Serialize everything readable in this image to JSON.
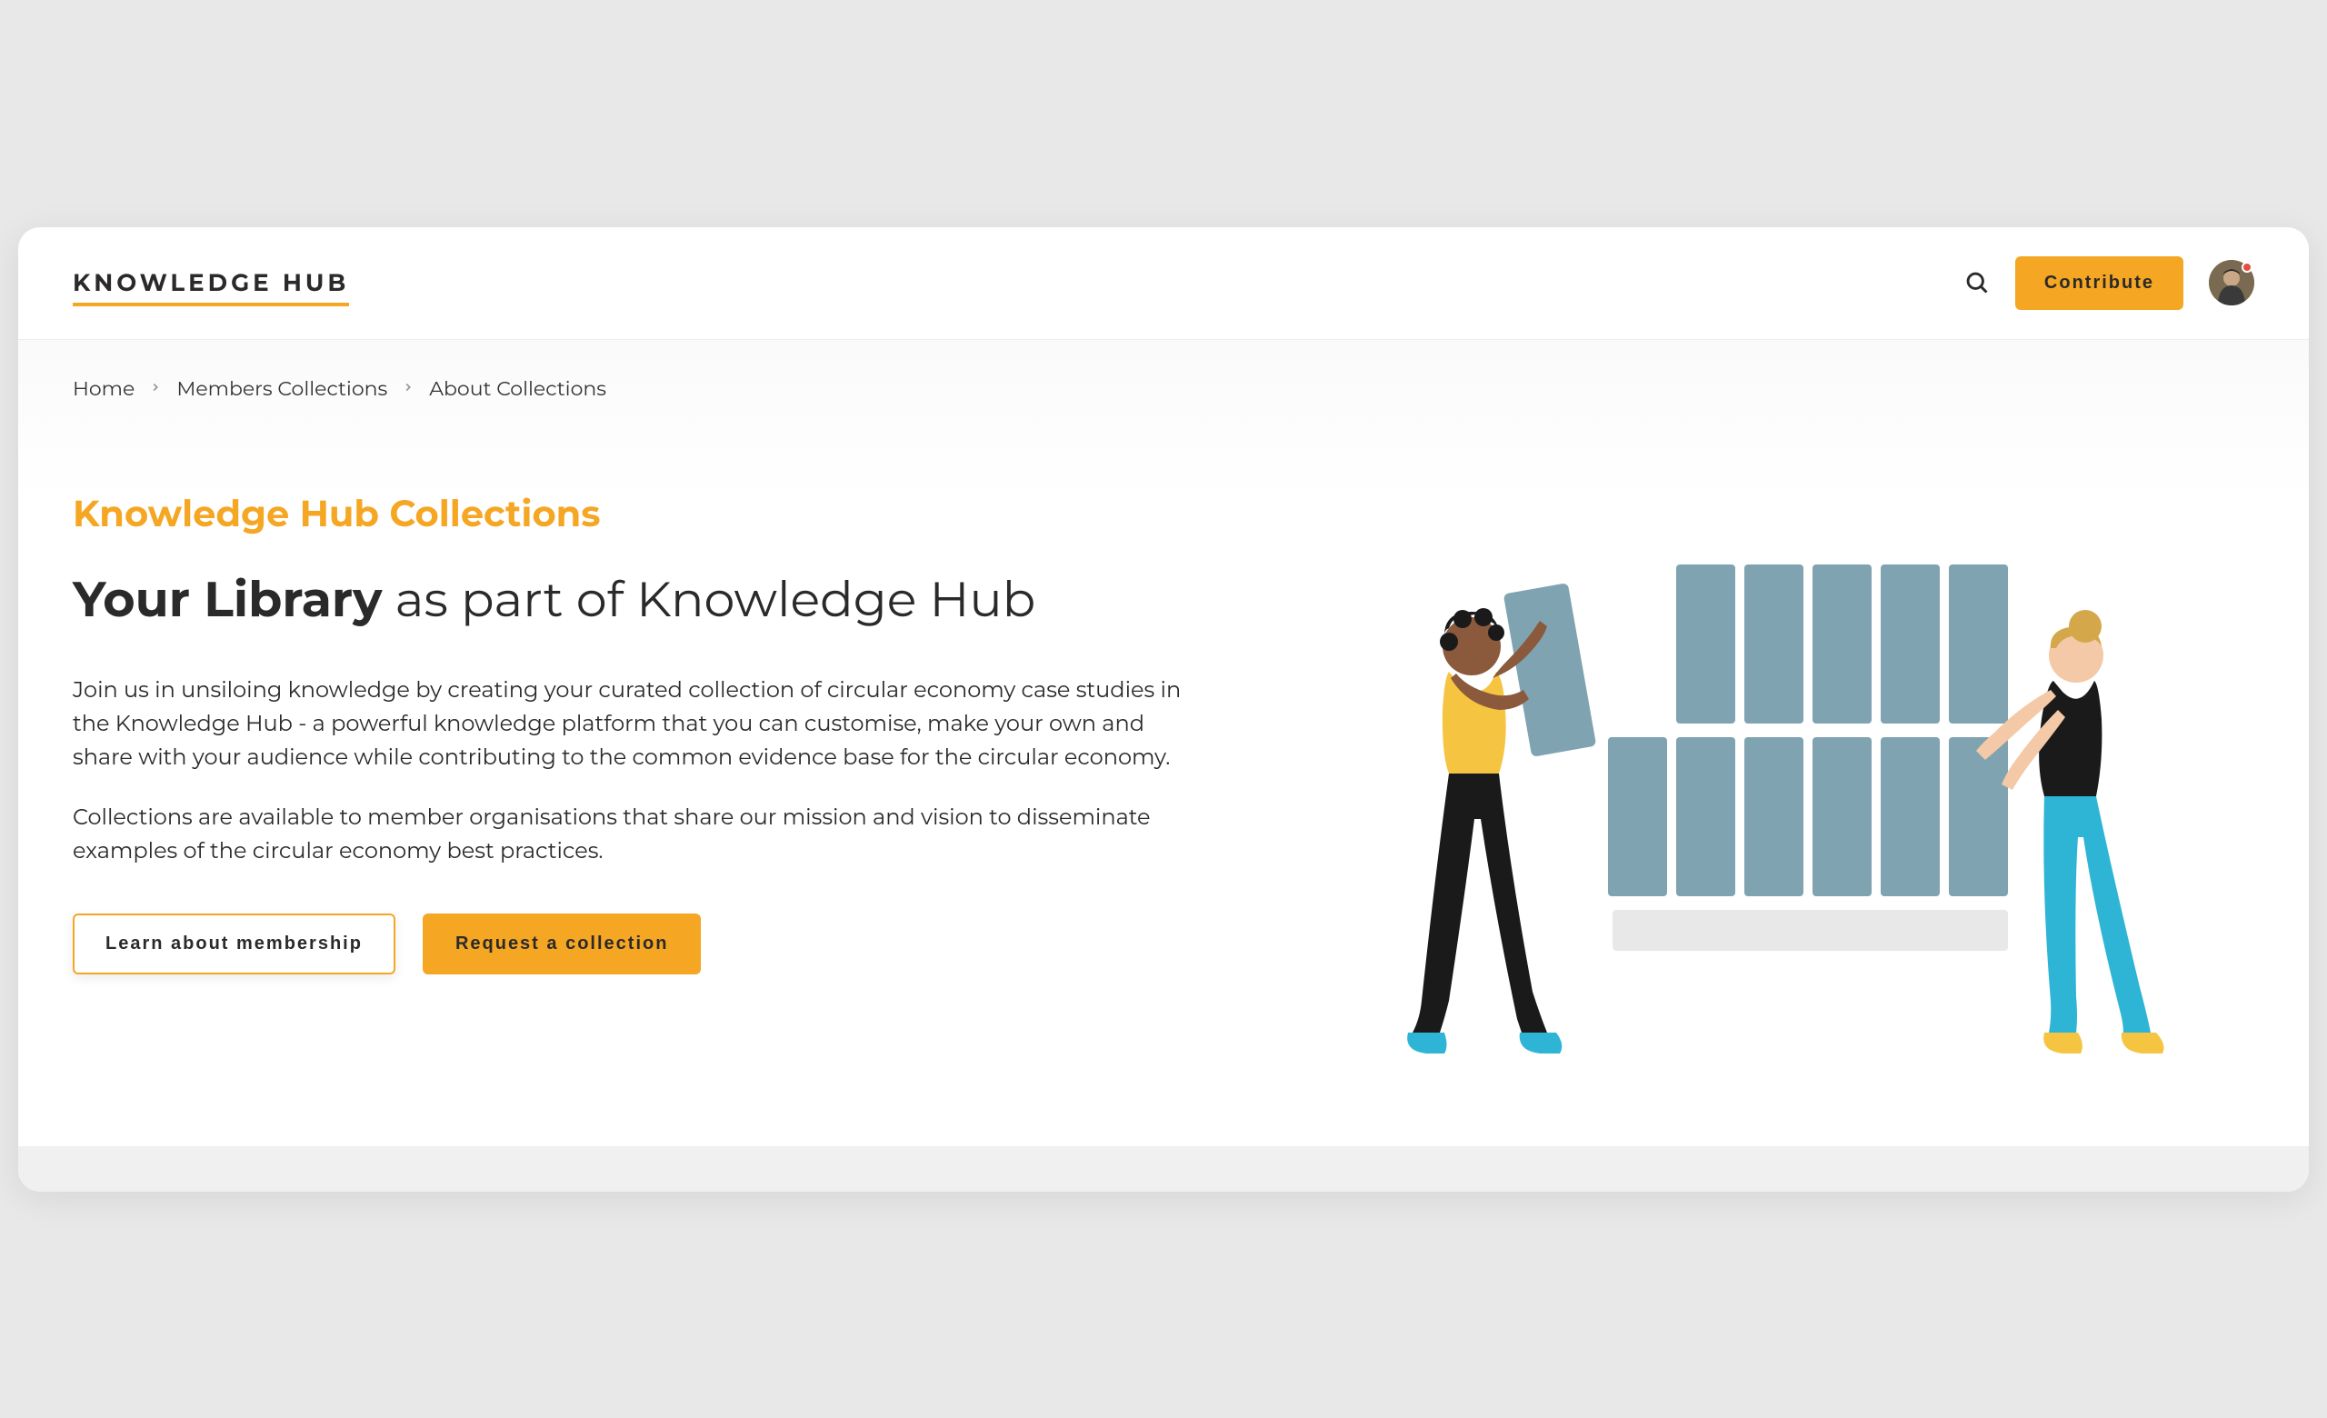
{
  "header": {
    "logo": "KNOWLEDGE HUB",
    "contribute_label": "Contribute"
  },
  "breadcrumb": {
    "items": [
      "Home",
      "Members Collections",
      "About Collections"
    ]
  },
  "hero": {
    "eyebrow": "Knowledge Hub Collections",
    "heading_bold": "Your Library",
    "heading_rest": " as part of Knowledge Hub",
    "paragraph1": "Join us in unsiloing knowledge by creating your curated collection of circular economy case studies in the Knowledge Hub - a powerful knowledge platform that you can customise, make your own and share with your audience while contributing to the common evidence base for the circular economy.",
    "paragraph2": "Collections are available to member organisations that share our mission and vision to disseminate examples of the circular economy best practices.",
    "cta_secondary": "Learn about membership",
    "cta_primary": "Request a collection"
  },
  "colors": {
    "accent": "#f5a623",
    "text": "#2a2a2a"
  }
}
